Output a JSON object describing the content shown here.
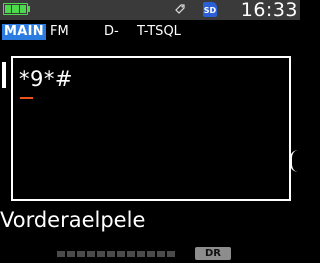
{
  "status_bar": {
    "battery_icon": "battery-full-icon",
    "tag_icon": "tag-icon",
    "sd_label": "SD",
    "time": "16:33"
  },
  "header": {
    "band": "MAIN",
    "mode": "FM",
    "dv": "D-",
    "tone": "T-TSQL"
  },
  "popup": {
    "input_value": "*9*#"
  },
  "channel": {
    "name": "Vorderaelpele"
  },
  "footer": {
    "dr_label": "DR",
    "meter_level": 0
  },
  "colors": {
    "status_bar_bg": "#3a3a3a",
    "battery": "#4ed84e",
    "main_badge": "#2b7be0",
    "sd_badge": "#2a5fd6",
    "cursor": "#e8541a",
    "dr_badge": "#8d8d8d"
  }
}
